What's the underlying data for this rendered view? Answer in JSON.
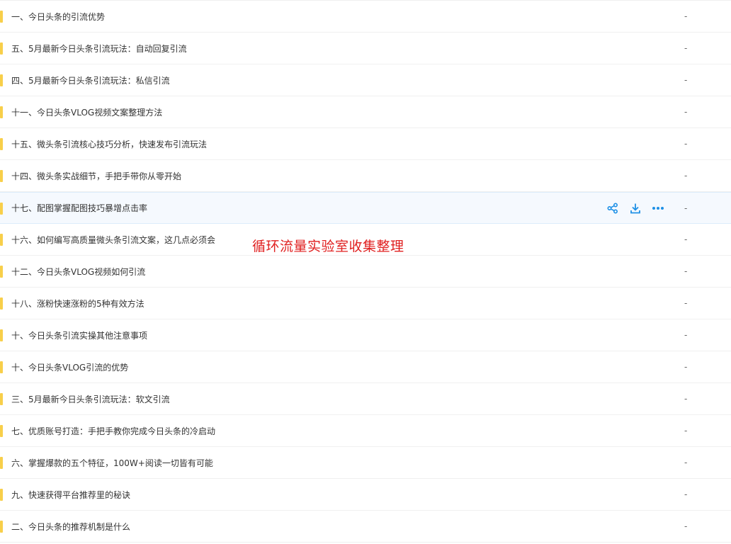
{
  "colors": {
    "folder": "#f8cf4a",
    "action_icon": "#1e90e6",
    "watermark": "#e02020"
  },
  "rows": [
    {
      "name": "一、今日头条的引流优势",
      "size": "-"
    },
    {
      "name": "五、5月最新今日头条引流玩法：自动回复引流",
      "size": "-"
    },
    {
      "name": "四、5月最新今日头条引流玩法：私信引流",
      "size": "-"
    },
    {
      "name": "十一、今日头条VLOG视频文案整理方法",
      "size": "-"
    },
    {
      "name": "十五、微头条引流核心技巧分析，快速发布引流玩法",
      "size": "-"
    },
    {
      "name": "十四、微头条实战细节，手把手带你从零开始",
      "size": "-"
    },
    {
      "name": "十七、配图掌握配图技巧暴增点击率",
      "size": "-"
    },
    {
      "name": "十六、如何编写高质量微头条引流文案，这几点必须会",
      "size": "-"
    },
    {
      "name": "十二、今日头条VLOG视频如何引流",
      "size": "-"
    },
    {
      "name": "十八、涨粉快速涨粉的5种有效方法",
      "size": "-"
    },
    {
      "name": "十、今日头条引流实操其他注意事项",
      "size": "-"
    },
    {
      "name": "十、今日头条VLOG引流的优势",
      "size": "-"
    },
    {
      "name": "三、5月最新今日头条引流玩法：软文引流",
      "size": "-"
    },
    {
      "name": "七、优质账号打造：手把手教你完成今日头条的冷启动",
      "size": "-"
    },
    {
      "name": "六、掌握爆款的五个特征，100W+阅读一切皆有可能",
      "size": "-"
    },
    {
      "name": "九、快速获得平台推荐里的秘诀",
      "size": "-"
    },
    {
      "name": "二、今日头条的推荐机制是什么",
      "size": "-"
    }
  ],
  "hover_row_index": 6,
  "hover_actions": [
    "share-icon",
    "download-icon",
    "more-icon"
  ],
  "watermark": "循环流量实验室收集整理"
}
